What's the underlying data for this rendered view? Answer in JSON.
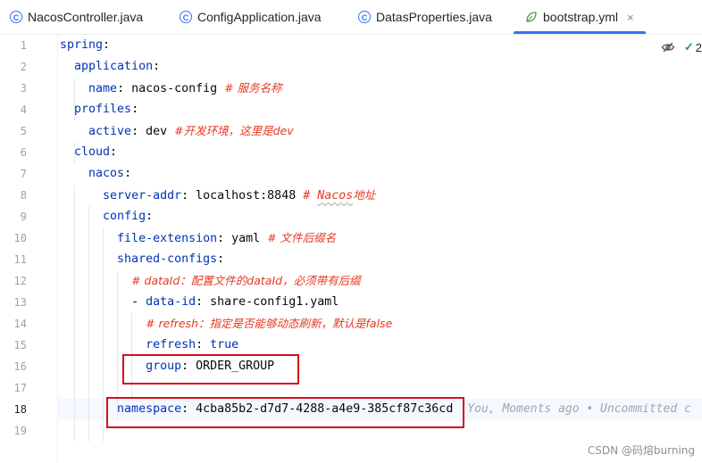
{
  "tabs": [
    {
      "label": "NacosController.java",
      "icon": "class-icon"
    },
    {
      "label": "ConfigApplication.java",
      "icon": "spring-class-icon"
    },
    {
      "label": "DatasProperties.java",
      "icon": "class-icon"
    },
    {
      "label": "bootstrap.yml",
      "icon": "yaml-leaf-icon",
      "active": true,
      "close": "×"
    }
  ],
  "inspection": {
    "count": "2"
  },
  "editor": {
    "current_line": "18",
    "line_numbers": [
      "1",
      "2",
      "3",
      "4",
      "5",
      "6",
      "7",
      "8",
      "9",
      "10",
      "11",
      "12",
      "13",
      "14",
      "15",
      "16",
      "17",
      "18",
      "19"
    ],
    "lines": {
      "l1": {
        "key": "spring"
      },
      "l2": {
        "key": "application"
      },
      "l3": {
        "key": "name",
        "value": "nacos-config",
        "comment": "# 服务名称"
      },
      "l4": {
        "key": "profiles"
      },
      "l5": {
        "key": "active",
        "value": "dev",
        "comment": "#开发环境，这里是dev"
      },
      "l6": {
        "key": "cloud"
      },
      "l7": {
        "key": "nacos"
      },
      "l8": {
        "key": "server-addr",
        "value": "localhost:8848",
        "comment_hash": "#",
        "comment_word": "Nacos",
        "comment_rest": "地址"
      },
      "l9": {
        "key": "config"
      },
      "l10": {
        "key": "file-extension",
        "value": "yaml",
        "comment": "# 文件后缀名"
      },
      "l11": {
        "key": "shared-configs"
      },
      "l12": {
        "comment": "# dataId：配置文件的dataId，必须带有后缀"
      },
      "l13": {
        "dash": "-",
        "key": "data-id",
        "value": "share-config1.yaml"
      },
      "l14": {
        "comment": "# refresh：指定是否能够动态刷新，默认是false"
      },
      "l15": {
        "key": "refresh",
        "value": "true"
      },
      "l16": {
        "key": "group",
        "value": "ORDER_GROUP"
      },
      "l18": {
        "key": "namespace",
        "value": "4cba85b2-d7d7-4288-a4e9-385cf87c36cd",
        "blame": "You, Moments ago • Uncommitted c"
      }
    }
  },
  "watermark": "CSDN @码熔burning",
  "colors": {
    "accent": "#3574f0",
    "key": "#0033b3",
    "comment": "#e8371f",
    "highlight_box": "#d40f1d"
  }
}
